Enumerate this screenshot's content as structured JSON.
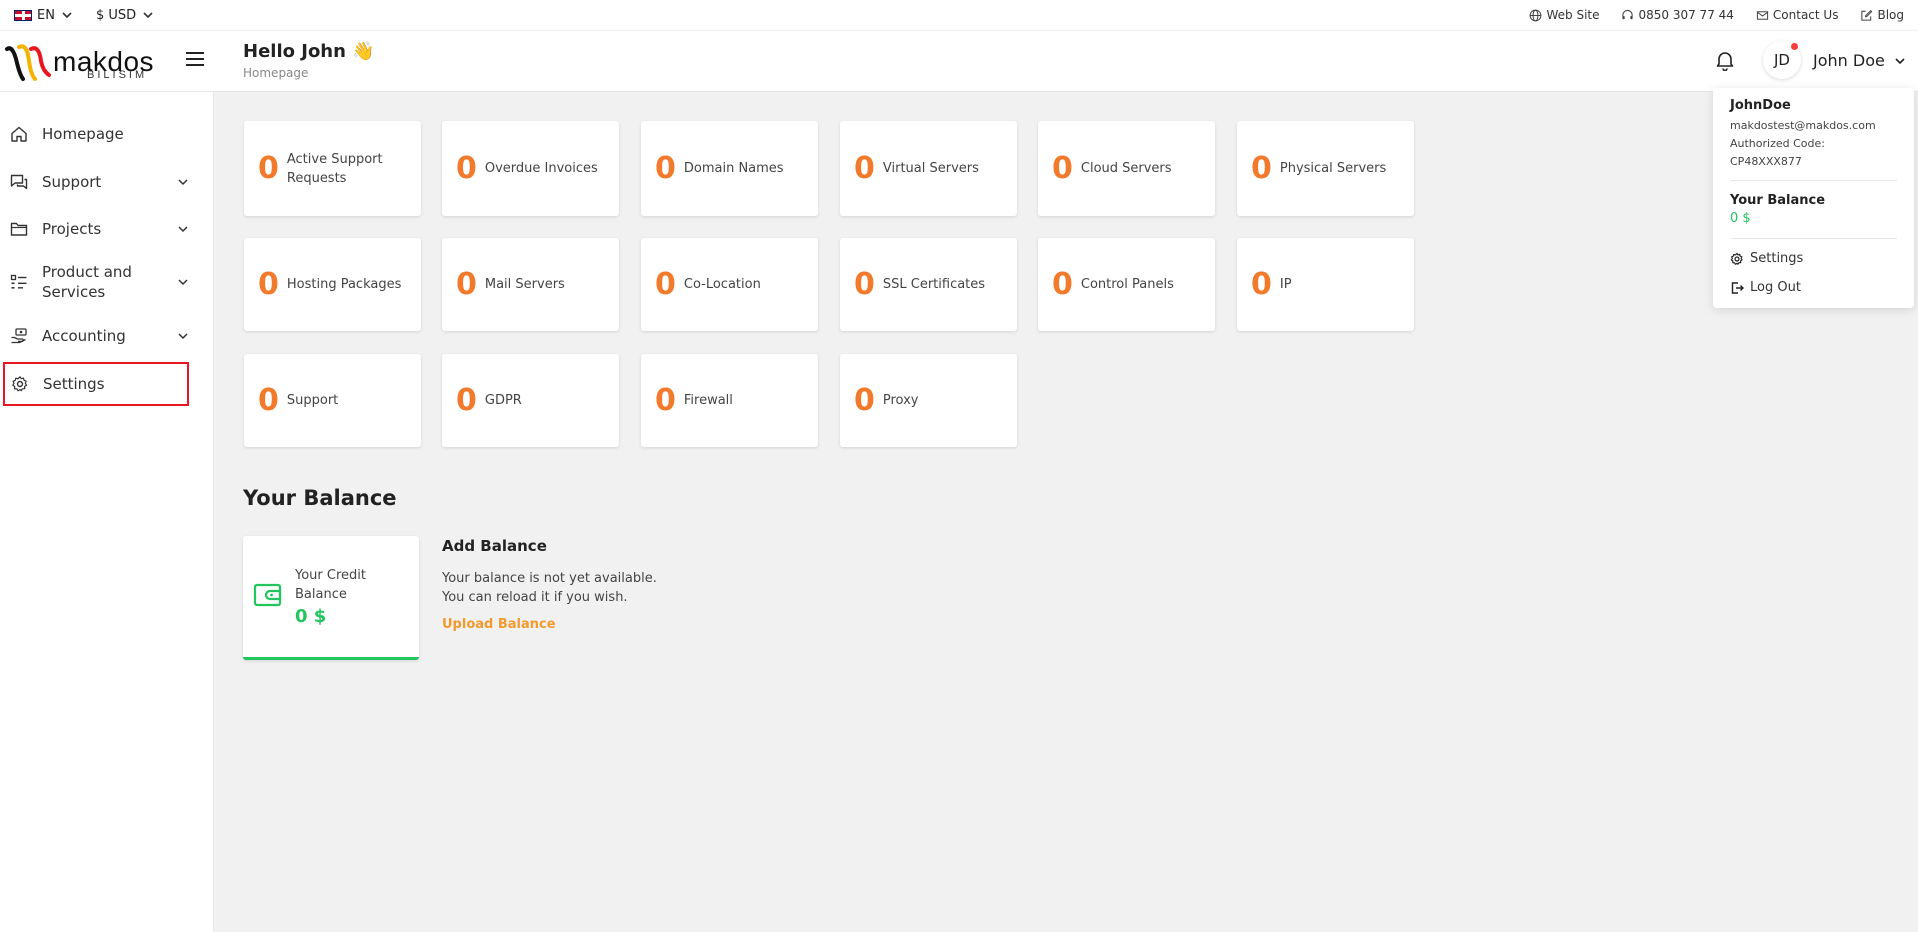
{
  "topbar": {
    "language": "EN",
    "currency": "$ USD",
    "links": [
      {
        "label": "Web Site",
        "icon": "globe-icon"
      },
      {
        "label": "0850 307 77 44",
        "icon": "headset-icon"
      },
      {
        "label": "Contact Us",
        "icon": "mail-icon"
      },
      {
        "label": "Blog",
        "icon": "edit-icon"
      }
    ]
  },
  "header": {
    "logo_text": "makdos",
    "logo_sub": "BILISIM",
    "greeting": "Hello John 👋",
    "breadcrumb": "Homepage",
    "avatar_initials": "JD",
    "user_name": "John Doe"
  },
  "sidebar": {
    "items": [
      {
        "label": "Homepage",
        "icon": "home-icon",
        "expandable": false
      },
      {
        "label": "Support",
        "icon": "chat-icon",
        "expandable": true
      },
      {
        "label": "Projects",
        "icon": "folder-icon",
        "expandable": true
      },
      {
        "label": "Product and Services",
        "icon": "list-icon",
        "expandable": true
      },
      {
        "label": "Accounting",
        "icon": "money-hand-icon",
        "expandable": true
      },
      {
        "label": "Settings",
        "icon": "gear-icon",
        "expandable": false,
        "highlighted": true
      }
    ]
  },
  "stats": [
    {
      "count": "0",
      "label": "Active Support Requests"
    },
    {
      "count": "0",
      "label": "Overdue Invoices"
    },
    {
      "count": "0",
      "label": "Domain Names"
    },
    {
      "count": "0",
      "label": "Virtual Servers"
    },
    {
      "count": "0",
      "label": "Cloud Servers"
    },
    {
      "count": "0",
      "label": "Physical Servers"
    },
    {
      "count": "0",
      "label": "Hosting Packages"
    },
    {
      "count": "0",
      "label": "Mail Servers"
    },
    {
      "count": "0",
      "label": "Co-Location"
    },
    {
      "count": "0",
      "label": "SSL Certificates"
    },
    {
      "count": "0",
      "label": "Control Panels"
    },
    {
      "count": "0",
      "label": "IP"
    },
    {
      "count": "0",
      "label": "Support"
    },
    {
      "count": "0",
      "label": "GDPR"
    },
    {
      "count": "0",
      "label": "Firewall"
    },
    {
      "count": "0",
      "label": "Proxy"
    }
  ],
  "balance": {
    "section_title": "Your Balance",
    "credit_label": "Your Credit Balance",
    "credit_value": "0 $",
    "add_title": "Add Balance",
    "add_text_1": "Your balance is not yet available.",
    "add_text_2": "You can reload it if you wish.",
    "add_link": "Upload Balance"
  },
  "dropdown": {
    "username": "JohnDoe",
    "email": "makdostest@makdos.com",
    "auth_code": "Authorized Code: CP48XXX877",
    "balance_label": "Your Balance",
    "balance_value": "0 $",
    "settings_label": "Settings",
    "logout_label": "Log Out"
  },
  "colors": {
    "accent_orange": "#f27a2c",
    "success_green": "#22c55e",
    "highlight_red": "#e8161f"
  }
}
